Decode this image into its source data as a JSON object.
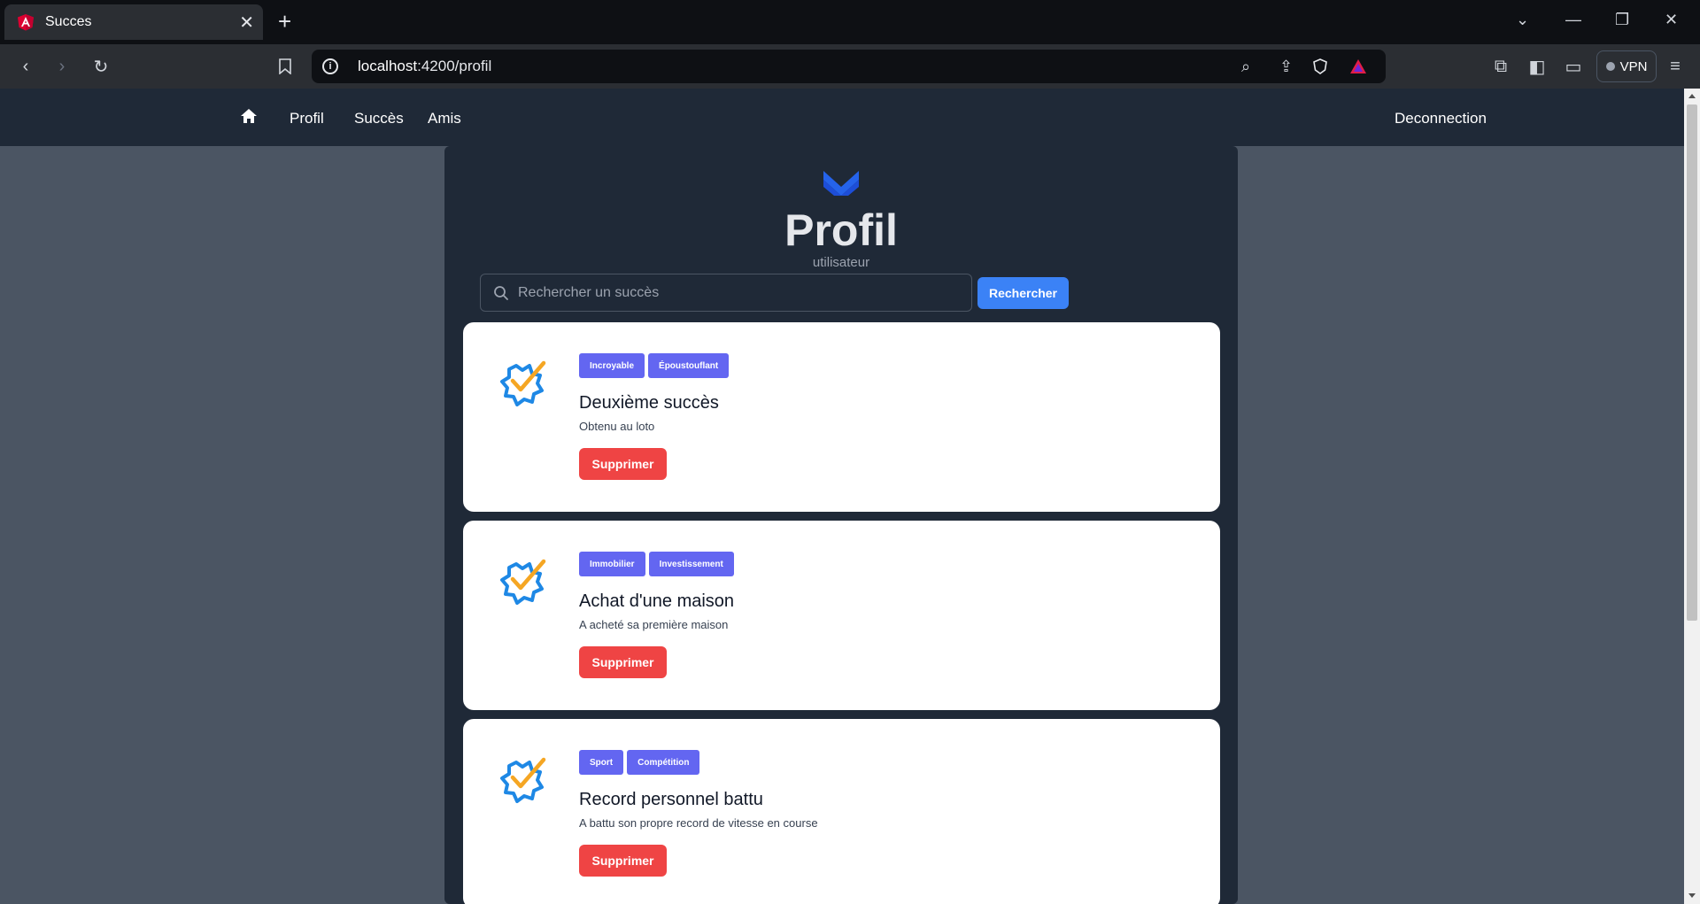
{
  "browser": {
    "tab_title": "Succes",
    "url_host": "localhost",
    "url_path": ":4200/profil",
    "vpn_label": "VPN"
  },
  "nav": {
    "links": [
      "Profil",
      "Succès",
      "Amis"
    ],
    "logout": "Deconnection"
  },
  "profile": {
    "title": "Profil",
    "subtitle": "utilisateur",
    "search_placeholder": "Rechercher un succès",
    "search_button": "Rechercher"
  },
  "achievements": [
    {
      "tags": [
        "Incroyable",
        "Époustouflant"
      ],
      "title": "Deuxième succès",
      "description": "Obtenu au loto",
      "delete_label": "Supprimer"
    },
    {
      "tags": [
        "Immobilier",
        "Investissement"
      ],
      "title": "Achat d'une maison",
      "description": "A acheté sa première maison",
      "delete_label": "Supprimer"
    },
    {
      "tags": [
        "Sport",
        "Compétition"
      ],
      "title": "Record personnel battu",
      "description": "A battu son propre record de vitesse en course",
      "delete_label": "Supprimer"
    }
  ],
  "colors": {
    "navbar": "#1f2937",
    "page_bg": "#4b5563",
    "accent_blue": "#3b82f6",
    "tag": "#6366f1",
    "danger": "#ef4444",
    "icon_blue": "#1e88e5",
    "icon_check": "#f5a623"
  }
}
